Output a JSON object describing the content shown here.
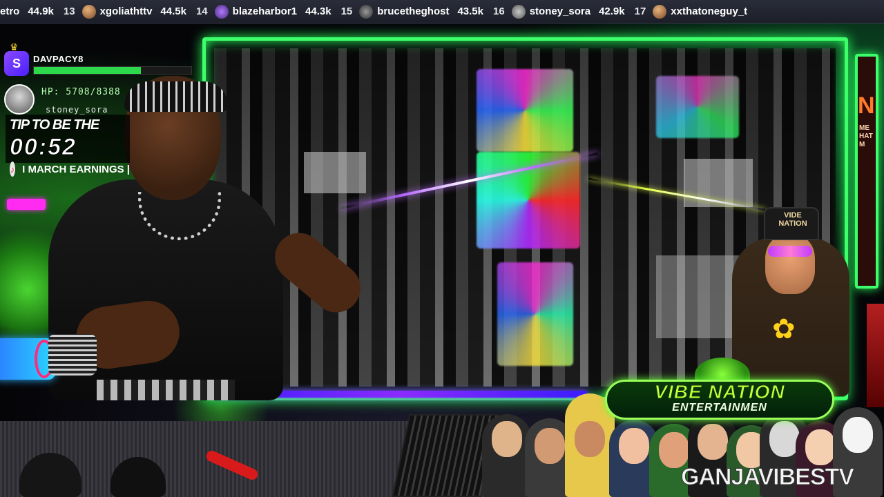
{
  "ticker": {
    "items": [
      {
        "rank": "",
        "name": "etro",
        "value": "44.9k"
      },
      {
        "rank": "13",
        "name": "xgoliathttv",
        "value": "44.5k"
      },
      {
        "rank": "14",
        "name": "blazeharbor1",
        "value": "44.3k"
      },
      {
        "rank": "15",
        "name": "brucetheghost",
        "value": "43.5k"
      },
      {
        "rank": "16",
        "name": "stoney_sora",
        "value": "42.9k"
      },
      {
        "rank": "17",
        "name": "xxthatoneguy_t",
        "value": ""
      }
    ]
  },
  "hp_card": {
    "badge_letter": "S",
    "username": "DAVPACY8",
    "hp_text": "HP: 5708/8388",
    "hp_fraction": 0.68,
    "avatar_user": "stoney_sora"
  },
  "tip_panel": {
    "title": "TIP TO BE THE",
    "timer": "00:52",
    "earnings": "I MARCH EARNINGS |"
  },
  "side_panel": {
    "letter": "N",
    "text": "ME\nHAT\nM"
  },
  "vibe_nation": {
    "hat_text": "VIDE\nNATION",
    "logo_title": "VIBE NATION",
    "logo_sub": "ENTERTAINMEN",
    "channel": "GANJAVIBESTV"
  },
  "colors": {
    "frame_green": "#3dff6a",
    "hp_green": "#2bd94a",
    "accent_pink": "#ff2bf0",
    "accent_purple": "#7a3bff"
  }
}
